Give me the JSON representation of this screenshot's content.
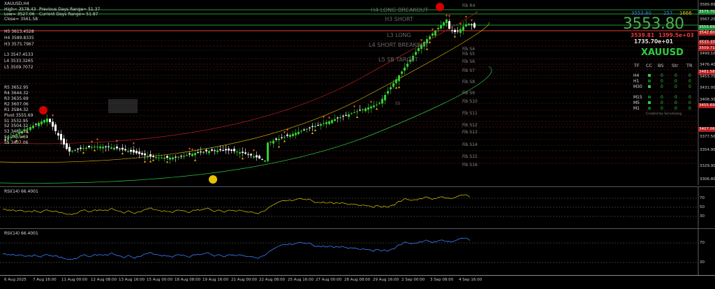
{
  "symbol_bar": {
    "title": "XAUUSD,H4"
  },
  "info": {
    "high": "High= 3578.43",
    "prev_range": "Previous Days Range= 51.37",
    "low": "Low= 3527.06",
    "curr_range": "Current Days Range= 51.87",
    "close": "Close= 3561.58"
  },
  "upper_levels": [
    "H5 3613.4528",
    "H4 3589.8335",
    "H3 3575.7967"
  ],
  "lower_levels": [
    "L3 3547.4533",
    "L4 3533.3265",
    "L5 3509.7072"
  ],
  "pivots": [
    "R5 3652.95",
    "R4 3644.32",
    "R3 3635.69",
    "R2 3607.06",
    "R1 3584.32",
    "Pivot 3555.69",
    "S1 3532.95",
    "S2 3504.32",
    "S3 3481.58",
    "S4 3455.69",
    "S5 3407.06"
  ],
  "annotations": {
    "h4_long_breakout": "H4 LONG BREAKOUT",
    "h3_short": "H3 SHORT",
    "l3_long": "L3 LONG",
    "l4_short_breakout": "L4 SHORT BREAKOUT",
    "l5_sb_target": "L5 SB TARGET",
    "s5": "S5"
  },
  "fib_labels": [
    "Fib R4",
    "Fib S4",
    "Fib S5",
    "Fib S6",
    "Fib S7",
    "Fib S8",
    "Fib S9",
    "Fib S10",
    "Fib S11",
    "Fib S12",
    "Fib S13",
    "Fib S14",
    "Fib S15",
    "Fib S16"
  ],
  "panel": {
    "top_vals": [
      "3553.80",
      "257",
      "1666"
    ],
    "big_price": "3553.80",
    "red_vals": [
      "3539.81",
      "1399.5e+03"
    ],
    "green_vals": [
      "1735.70e+01"
    ],
    "symbol": "XAUUSD",
    "mtf_headers": [
      "TF",
      "CC",
      "BS",
      "Str",
      "TR"
    ],
    "mtf_rows": [
      "H4",
      "H1",
      "M30",
      "M15",
      "M5",
      "M1"
    ],
    "zero": "0",
    "credit": "Created by ServeGang"
  },
  "price_axis": [
    "3589.89",
    "3567.20",
    "3544.50",
    "3521.80",
    "3499.10",
    "3476.40",
    "3453.70",
    "3431.00",
    "3408.30",
    "3377.50",
    "3354.90",
    "3329.90",
    "3306.80"
  ],
  "price_axis_boxes": [
    {
      "label": "3575.70",
      "color": "#1e8c32"
    },
    {
      "label": "3555.69",
      "color": "#1e8c32"
    },
    {
      "label": "3542.80",
      "color": "#b71c1c"
    },
    {
      "label": "3533.33",
      "color": "#b71c1c"
    },
    {
      "label": "3509.71",
      "color": "#b71c1c"
    },
    {
      "label": "3481.58",
      "color": "#b71c1c"
    },
    {
      "label": "3455.69",
      "color": "#b71c1c"
    },
    {
      "label": "3407.06",
      "color": "#b71c1c"
    }
  ],
  "rsi1": {
    "label": "RSI(14) 66.4001",
    "levels": [
      "70",
      "50",
      "30"
    ],
    "color": "#c8b400"
  },
  "rsi2": {
    "label": "RSI(14) 66.4001",
    "levels": [
      "70",
      "30"
    ],
    "color": "#3d7cff"
  },
  "time_axis": [
    "6 Aug 2025",
    "7 Aug 16:00",
    "11 Aug 00:00",
    "12 Aug 08:00",
    "13 Aug 16:00",
    "15 Aug 00:00",
    "18 Aug 08:00",
    "19 Aug 16:00",
    "21 Aug 00:00",
    "22 Aug 08:00",
    "25 Aug 16:00",
    "27 Aug 00:00",
    "28 Aug 08:00",
    "29 Aug 16:00",
    "2 Sep 00:00",
    "3 Sep 08:00",
    "4 Sep 16:00"
  ],
  "colors": {
    "bull": "#33cc33",
    "bear": "#ffffff",
    "accent": "#2ecc40",
    "level_red": "#b71c1c"
  }
}
